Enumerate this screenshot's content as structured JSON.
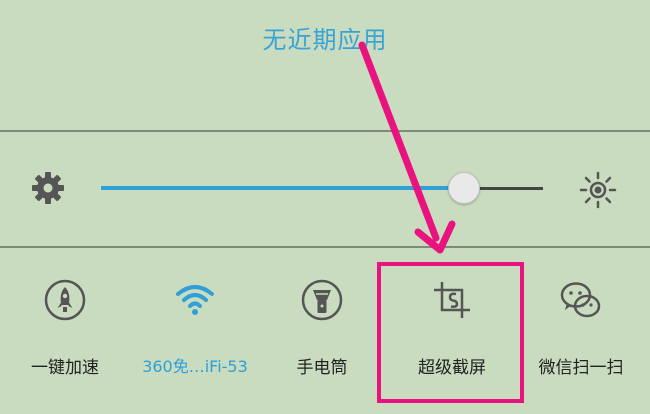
{
  "recent_apps": {
    "empty_text": "无近期应用"
  },
  "brightness": {
    "level": 0.83,
    "accent_color": "#2ea0d8"
  },
  "quick_settings": [
    {
      "label": "一键加速",
      "icon": "rocket-icon",
      "active": false
    },
    {
      "label": "360免…iFi-53",
      "icon": "wifi-icon",
      "active": true
    },
    {
      "label": "手电筒",
      "icon": "flashlight-icon",
      "active": false
    },
    {
      "label": "超级截屏",
      "icon": "screenshot-crop-icon",
      "active": false
    },
    {
      "label": "微信扫一扫",
      "icon": "wechat-icon",
      "active": false
    }
  ],
  "annotation": {
    "highlight_color": "#e8137f"
  }
}
